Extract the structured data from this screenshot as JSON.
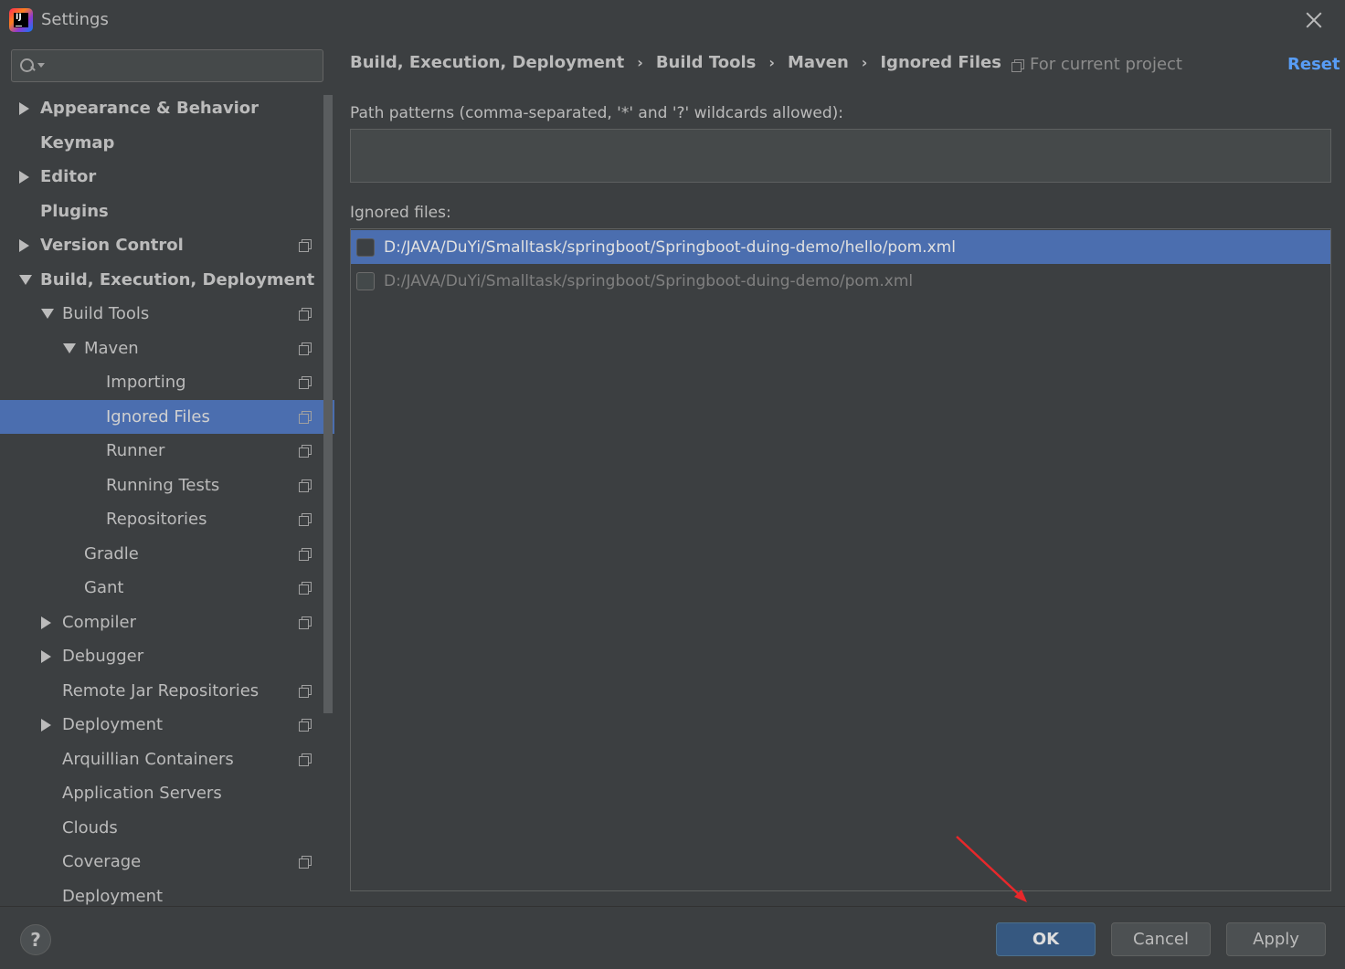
{
  "window": {
    "title": "Settings"
  },
  "search": {
    "value": "",
    "placeholder": ""
  },
  "sidebar": {
    "items": [
      {
        "label": "Appearance & Behavior",
        "expand": "right",
        "bold": true,
        "indent": 0,
        "project": false,
        "selected": false
      },
      {
        "label": "Keymap",
        "expand": "none",
        "bold": true,
        "indent": 0,
        "project": false,
        "selected": false
      },
      {
        "label": "Editor",
        "expand": "right",
        "bold": true,
        "indent": 0,
        "project": false,
        "selected": false
      },
      {
        "label": "Plugins",
        "expand": "none",
        "bold": true,
        "indent": 0,
        "project": false,
        "selected": false
      },
      {
        "label": "Version Control",
        "expand": "right",
        "bold": true,
        "indent": 0,
        "project": true,
        "selected": false
      },
      {
        "label": "Build, Execution, Deployment",
        "expand": "down",
        "bold": true,
        "indent": 0,
        "project": false,
        "selected": false
      },
      {
        "label": "Build Tools",
        "expand": "down",
        "bold": false,
        "indent": 1,
        "project": true,
        "selected": false
      },
      {
        "label": "Maven",
        "expand": "down",
        "bold": false,
        "indent": 2,
        "project": true,
        "selected": false
      },
      {
        "label": "Importing",
        "expand": "none",
        "bold": false,
        "indent": 3,
        "project": true,
        "selected": false
      },
      {
        "label": "Ignored Files",
        "expand": "none",
        "bold": false,
        "indent": 3,
        "project": true,
        "selected": true
      },
      {
        "label": "Runner",
        "expand": "none",
        "bold": false,
        "indent": 3,
        "project": true,
        "selected": false
      },
      {
        "label": "Running Tests",
        "expand": "none",
        "bold": false,
        "indent": 3,
        "project": true,
        "selected": false
      },
      {
        "label": "Repositories",
        "expand": "none",
        "bold": false,
        "indent": 3,
        "project": true,
        "selected": false
      },
      {
        "label": "Gradle",
        "expand": "none",
        "bold": false,
        "indent": 2,
        "project": true,
        "selected": false
      },
      {
        "label": "Gant",
        "expand": "none",
        "bold": false,
        "indent": 2,
        "project": true,
        "selected": false
      },
      {
        "label": "Compiler",
        "expand": "right",
        "bold": false,
        "indent": 1,
        "project": true,
        "selected": false
      },
      {
        "label": "Debugger",
        "expand": "right",
        "bold": false,
        "indent": 1,
        "project": false,
        "selected": false
      },
      {
        "label": "Remote Jar Repositories",
        "expand": "none",
        "bold": false,
        "indent": 1,
        "project": true,
        "selected": false
      },
      {
        "label": "Deployment",
        "expand": "right",
        "bold": false,
        "indent": 1,
        "project": true,
        "selected": false
      },
      {
        "label": "Arquillian Containers",
        "expand": "none",
        "bold": false,
        "indent": 1,
        "project": true,
        "selected": false
      },
      {
        "label": "Application Servers",
        "expand": "none",
        "bold": false,
        "indent": 1,
        "project": false,
        "selected": false
      },
      {
        "label": "Clouds",
        "expand": "none",
        "bold": false,
        "indent": 1,
        "project": false,
        "selected": false
      },
      {
        "label": "Coverage",
        "expand": "none",
        "bold": false,
        "indent": 1,
        "project": true,
        "selected": false
      },
      {
        "label": "Deployment",
        "expand": "none",
        "bold": false,
        "indent": 1,
        "project": false,
        "selected": false
      }
    ]
  },
  "breadcrumb": [
    "Build, Execution, Deployment",
    "Build Tools",
    "Maven",
    "Ignored Files"
  ],
  "breadcrumb_separator": "›",
  "scope": {
    "label": "For current project"
  },
  "reset": {
    "label": "Reset"
  },
  "patterns": {
    "label": "Path patterns (comma-separated, '*' and '?' wildcards allowed):",
    "value": ""
  },
  "ignored": {
    "label": "Ignored files:",
    "rows": [
      {
        "path": "D:/JAVA/DuYi/Smalltask/springboot/Springboot-duing-demo/hello/pom.xml",
        "checked": false,
        "selected": true
      },
      {
        "path": "D:/JAVA/DuYi/Smalltask/springboot/Springboot-duing-demo/pom.xml",
        "checked": false,
        "selected": false
      }
    ]
  },
  "buttons": {
    "help": "?",
    "ok": "OK",
    "cancel": "Cancel",
    "apply": "Apply"
  },
  "colors": {
    "accent": "#4b6eaf",
    "link": "#589df6",
    "primary_button": "#365880",
    "annotation_arrow": "#e8282b"
  }
}
